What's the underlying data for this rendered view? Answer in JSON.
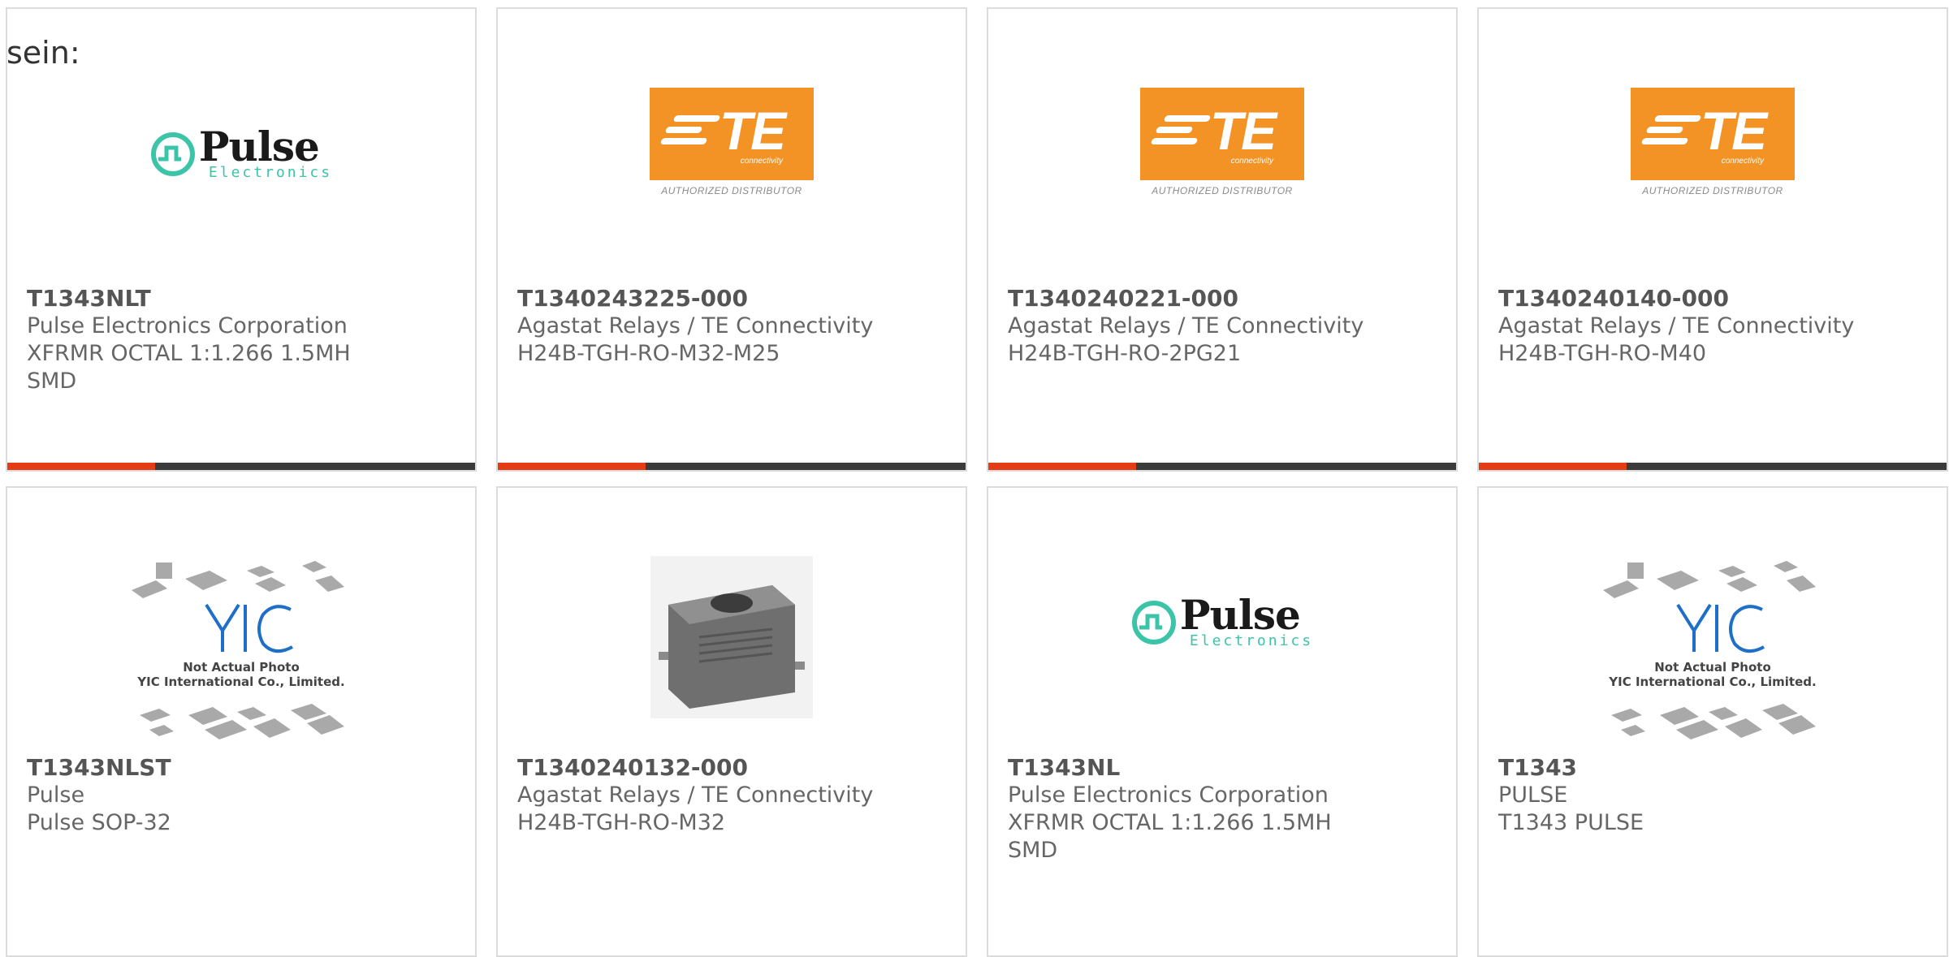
{
  "intro_text": "sein:",
  "accent_color": "#e43d16",
  "bar_color": "#3b3b3b",
  "te_logo": {
    "brand": "TE",
    "subtext": "connectivity",
    "distributor": "AUTHORIZED DISTRIBUTOR"
  },
  "pulse_logo": {
    "brand": "Pulse",
    "subtext": "Electronics"
  },
  "yic_logo": {
    "line1": "Not Actual Photo",
    "line2": "YIC International Co., Limited."
  },
  "products": [
    {
      "part": "T1343NLT",
      "lines": [
        "Pulse Electronics Corporation",
        "XFRMR OCTAL 1:1.266 1.5MH",
        "SMD"
      ],
      "image": "pulse-logo"
    },
    {
      "part": "T1340243225-000",
      "lines": [
        "Agastat Relays / TE Connectivity",
        "H24B-TGH-RO-M32-M25"
      ],
      "image": "te-logo"
    },
    {
      "part": "T1340240221-000",
      "lines": [
        "Agastat Relays / TE Connectivity",
        "H24B-TGH-RO-2PG21"
      ],
      "image": "te-logo"
    },
    {
      "part": "T1340240140-000",
      "lines": [
        "Agastat Relays / TE Connectivity",
        "H24B-TGH-RO-M40"
      ],
      "image": "te-logo"
    },
    {
      "part": "T1343NLST",
      "lines": [
        "Pulse",
        "Pulse SOP-32"
      ],
      "image": "yic-placeholder"
    },
    {
      "part": "T1340240132-000",
      "lines": [
        "Agastat Relays / TE Connectivity",
        "H24B-TGH-RO-M32"
      ],
      "image": "connector-photo"
    },
    {
      "part": "T1343NL",
      "lines": [
        "Pulse Electronics Corporation",
        "XFRMR OCTAL 1:1.266 1.5MH",
        "SMD"
      ],
      "image": "pulse-logo"
    },
    {
      "part": "T1343",
      "lines": [
        "PULSE",
        "T1343 PULSE"
      ],
      "image": "yic-placeholder"
    }
  ]
}
